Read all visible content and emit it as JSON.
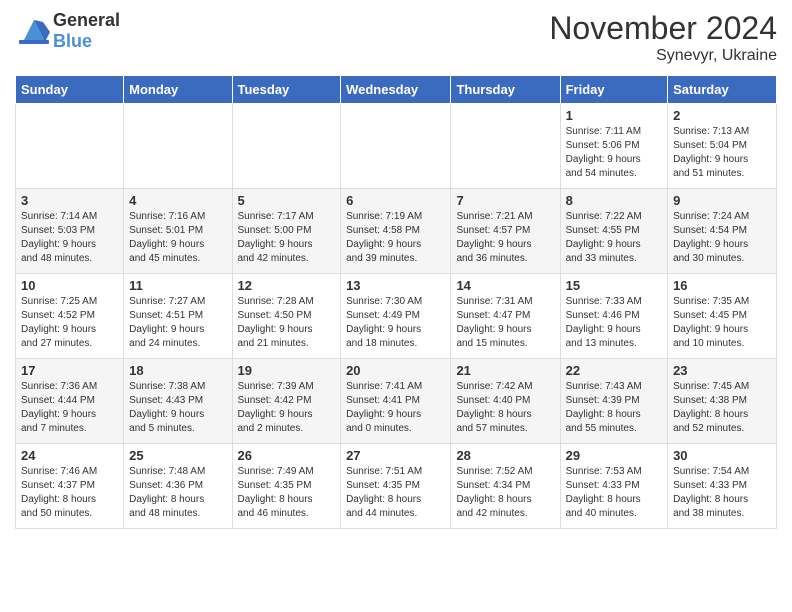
{
  "header": {
    "logo_text_general": "General",
    "logo_text_blue": "Blue",
    "month_title": "November 2024",
    "location": "Synevyr, Ukraine"
  },
  "weekdays": [
    "Sunday",
    "Monday",
    "Tuesday",
    "Wednesday",
    "Thursday",
    "Friday",
    "Saturday"
  ],
  "weeks": [
    [
      {
        "day": "",
        "info": ""
      },
      {
        "day": "",
        "info": ""
      },
      {
        "day": "",
        "info": ""
      },
      {
        "day": "",
        "info": ""
      },
      {
        "day": "",
        "info": ""
      },
      {
        "day": "1",
        "info": "Sunrise: 7:11 AM\nSunset: 5:06 PM\nDaylight: 9 hours\nand 54 minutes."
      },
      {
        "day": "2",
        "info": "Sunrise: 7:13 AM\nSunset: 5:04 PM\nDaylight: 9 hours\nand 51 minutes."
      }
    ],
    [
      {
        "day": "3",
        "info": "Sunrise: 7:14 AM\nSunset: 5:03 PM\nDaylight: 9 hours\nand 48 minutes."
      },
      {
        "day": "4",
        "info": "Sunrise: 7:16 AM\nSunset: 5:01 PM\nDaylight: 9 hours\nand 45 minutes."
      },
      {
        "day": "5",
        "info": "Sunrise: 7:17 AM\nSunset: 5:00 PM\nDaylight: 9 hours\nand 42 minutes."
      },
      {
        "day": "6",
        "info": "Sunrise: 7:19 AM\nSunset: 4:58 PM\nDaylight: 9 hours\nand 39 minutes."
      },
      {
        "day": "7",
        "info": "Sunrise: 7:21 AM\nSunset: 4:57 PM\nDaylight: 9 hours\nand 36 minutes."
      },
      {
        "day": "8",
        "info": "Sunrise: 7:22 AM\nSunset: 4:55 PM\nDaylight: 9 hours\nand 33 minutes."
      },
      {
        "day": "9",
        "info": "Sunrise: 7:24 AM\nSunset: 4:54 PM\nDaylight: 9 hours\nand 30 minutes."
      }
    ],
    [
      {
        "day": "10",
        "info": "Sunrise: 7:25 AM\nSunset: 4:52 PM\nDaylight: 9 hours\nand 27 minutes."
      },
      {
        "day": "11",
        "info": "Sunrise: 7:27 AM\nSunset: 4:51 PM\nDaylight: 9 hours\nand 24 minutes."
      },
      {
        "day": "12",
        "info": "Sunrise: 7:28 AM\nSunset: 4:50 PM\nDaylight: 9 hours\nand 21 minutes."
      },
      {
        "day": "13",
        "info": "Sunrise: 7:30 AM\nSunset: 4:49 PM\nDaylight: 9 hours\nand 18 minutes."
      },
      {
        "day": "14",
        "info": "Sunrise: 7:31 AM\nSunset: 4:47 PM\nDaylight: 9 hours\nand 15 minutes."
      },
      {
        "day": "15",
        "info": "Sunrise: 7:33 AM\nSunset: 4:46 PM\nDaylight: 9 hours\nand 13 minutes."
      },
      {
        "day": "16",
        "info": "Sunrise: 7:35 AM\nSunset: 4:45 PM\nDaylight: 9 hours\nand 10 minutes."
      }
    ],
    [
      {
        "day": "17",
        "info": "Sunrise: 7:36 AM\nSunset: 4:44 PM\nDaylight: 9 hours\nand 7 minutes."
      },
      {
        "day": "18",
        "info": "Sunrise: 7:38 AM\nSunset: 4:43 PM\nDaylight: 9 hours\nand 5 minutes."
      },
      {
        "day": "19",
        "info": "Sunrise: 7:39 AM\nSunset: 4:42 PM\nDaylight: 9 hours\nand 2 minutes."
      },
      {
        "day": "20",
        "info": "Sunrise: 7:41 AM\nSunset: 4:41 PM\nDaylight: 9 hours\nand 0 minutes."
      },
      {
        "day": "21",
        "info": "Sunrise: 7:42 AM\nSunset: 4:40 PM\nDaylight: 8 hours\nand 57 minutes."
      },
      {
        "day": "22",
        "info": "Sunrise: 7:43 AM\nSunset: 4:39 PM\nDaylight: 8 hours\nand 55 minutes."
      },
      {
        "day": "23",
        "info": "Sunrise: 7:45 AM\nSunset: 4:38 PM\nDaylight: 8 hours\nand 52 minutes."
      }
    ],
    [
      {
        "day": "24",
        "info": "Sunrise: 7:46 AM\nSunset: 4:37 PM\nDaylight: 8 hours\nand 50 minutes."
      },
      {
        "day": "25",
        "info": "Sunrise: 7:48 AM\nSunset: 4:36 PM\nDaylight: 8 hours\nand 48 minutes."
      },
      {
        "day": "26",
        "info": "Sunrise: 7:49 AM\nSunset: 4:35 PM\nDaylight: 8 hours\nand 46 minutes."
      },
      {
        "day": "27",
        "info": "Sunrise: 7:51 AM\nSunset: 4:35 PM\nDaylight: 8 hours\nand 44 minutes."
      },
      {
        "day": "28",
        "info": "Sunrise: 7:52 AM\nSunset: 4:34 PM\nDaylight: 8 hours\nand 42 minutes."
      },
      {
        "day": "29",
        "info": "Sunrise: 7:53 AM\nSunset: 4:33 PM\nDaylight: 8 hours\nand 40 minutes."
      },
      {
        "day": "30",
        "info": "Sunrise: 7:54 AM\nSunset: 4:33 PM\nDaylight: 8 hours\nand 38 minutes."
      }
    ]
  ]
}
